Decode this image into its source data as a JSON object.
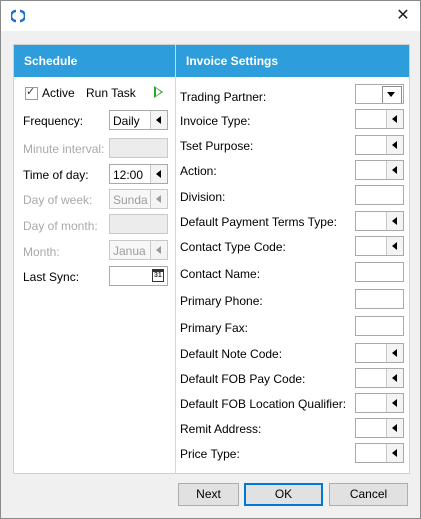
{
  "schedule": {
    "header": "Schedule",
    "active_label": "Active",
    "run_task_label": "Run Task",
    "frequency": {
      "label": "Frequency:",
      "value": "Daily"
    },
    "minute_interval": {
      "label": "Minute interval:",
      "value": ""
    },
    "time_of_day": {
      "label": "Time of day:",
      "value": "12:00"
    },
    "day_of_week": {
      "label": "Day of week:",
      "value": "Sunda"
    },
    "day_of_month": {
      "label": "Day of month:",
      "value": ""
    },
    "month": {
      "label": "Month:",
      "value": "Janua"
    },
    "last_sync": {
      "label": "Last Sync:",
      "value": ""
    },
    "calendar_day": "31"
  },
  "invoice": {
    "header": "Invoice Settings",
    "trading_partner": "Trading Partner:",
    "invoice_type": "Invoice Type:",
    "tset_purpose": "Tset Purpose:",
    "action": "Action:",
    "division": "Division:",
    "default_payment_terms_type": "Default Payment Terms Type:",
    "contact_type_code": "Contact Type Code:",
    "contact_name": "Contact Name:",
    "primary_phone": "Primary Phone:",
    "primary_fax": "Primary Fax:",
    "default_note_code": "Default Note Code:",
    "default_fob_pay_code": "Default FOB Pay Code:",
    "default_fob_location_qualifier": "Default FOB Location Qualifier:",
    "remit_address": "Remit Address:",
    "price_type": "Price Type:"
  },
  "buttons": {
    "next": "Next",
    "ok": "OK",
    "cancel": "Cancel"
  },
  "colors": {
    "header_bg": "#2d9ddc",
    "run_arrow": "#2aa52a",
    "app_icon": "#1f6fd1"
  }
}
